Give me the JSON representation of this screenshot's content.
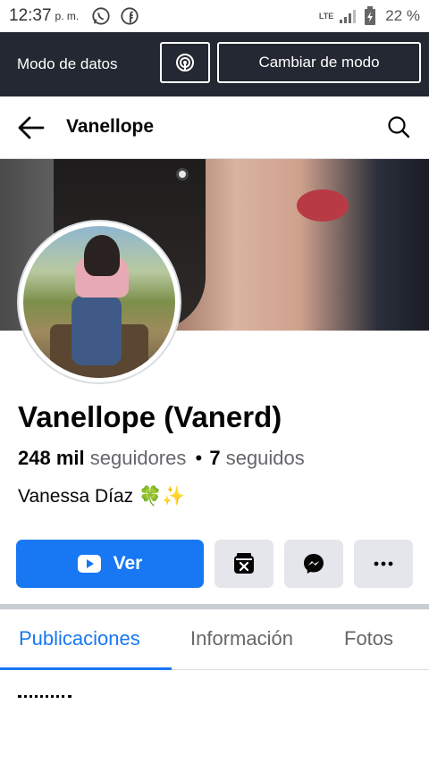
{
  "status_bar": {
    "time": "12:37",
    "ampm": "p. m.",
    "network": "LTE",
    "battery": "22 %",
    "app_icons": [
      "whatsapp-icon",
      "facebook-icon"
    ]
  },
  "data_mode_bar": {
    "label": "Modo de datos",
    "icon": "broadcast-icon",
    "switch_button": "Cambiar de modo"
  },
  "header": {
    "title": "Vanellope",
    "back_icon": "back-arrow-icon",
    "search_icon": "search-icon"
  },
  "profile": {
    "name": "Vanellope (Vanerd)",
    "followers_count": "248 mil",
    "followers_label": "seguidores",
    "separator": "•",
    "following_count": "7",
    "following_label": "seguidos",
    "bio": "Vanessa Díaz 🍀✨"
  },
  "actions": {
    "primary_label": "Ver",
    "primary_icon": "youtube-play-icon",
    "secondary_icons": [
      "calendar-x-icon",
      "messenger-icon",
      "more-icon"
    ]
  },
  "tabs": [
    {
      "label": "Publicaciones",
      "active": true
    },
    {
      "label": "Información",
      "active": false
    },
    {
      "label": "Fotos",
      "active": false
    }
  ],
  "colors": {
    "accent": "#1877f2",
    "data_bar_bg": "#232832",
    "secondary_btn_bg": "#e4e6eb",
    "muted_text": "#65676b"
  }
}
